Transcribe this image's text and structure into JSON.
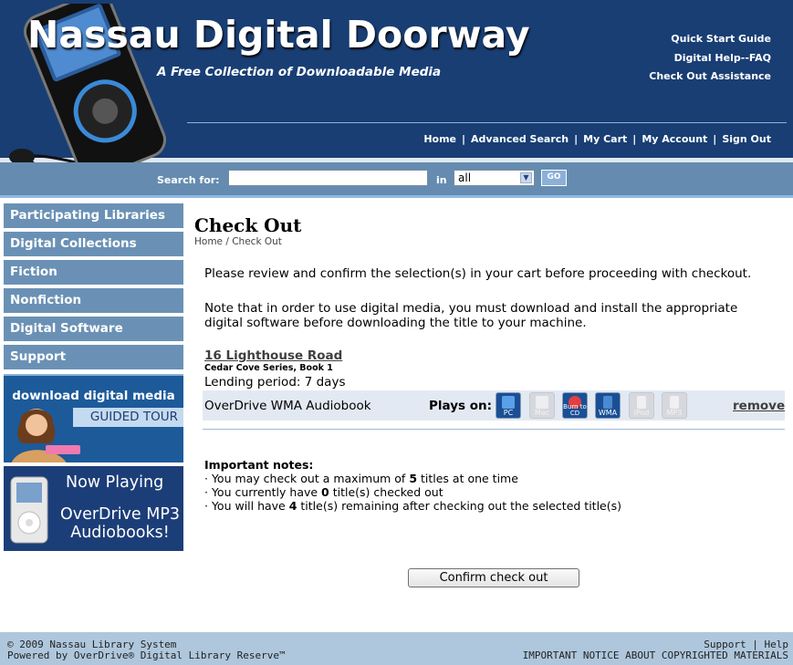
{
  "header": {
    "site_title": "Nassau Digital Doorway",
    "subtitle": "A Free Collection of Downloadable Media",
    "quick_links": [
      "Quick Start Guide",
      "Digital Help--FAQ",
      "Check Out Assistance"
    ],
    "nav": [
      "Home",
      "Advanced Search",
      "My Cart",
      "My Account",
      "Sign Out"
    ]
  },
  "search": {
    "label": "Search for:",
    "value": "",
    "in_label": "in",
    "scope": "all",
    "go_label": "GO"
  },
  "sidebar": {
    "items": [
      "Participating Libraries",
      "Digital Collections",
      "Fiction",
      "Nonfiction",
      "Digital Software",
      "Support"
    ],
    "promo_tour": {
      "line1": "download digital media",
      "line2": "GUIDED TOUR"
    },
    "promo_mp3": {
      "line1": "Now Playing",
      "line2": "OverDrive MP3",
      "line3": "Audiobooks!"
    }
  },
  "main": {
    "title": "Check Out",
    "breadcrumb": "Home / Check Out",
    "intro": "Please review and confirm the selection(s) in your cart before proceeding with checkout.",
    "note": "Note that in order to use digital media, you must download and install the appropriate digital software before downloading the title to your machine.",
    "item": {
      "title": "16 Lighthouse Road",
      "series": "Cedar Cove Series, Book 1",
      "lending": "Lending period: 7 days",
      "format": "OverDrive WMA Audiobook",
      "plays_on_label": "Plays on:",
      "devices": [
        {
          "name": "PC",
          "available": true,
          "color": "#1a4f95"
        },
        {
          "name": "Mac",
          "available": false,
          "color": "#d6d8de"
        },
        {
          "name": "Burn to CD",
          "available": true,
          "color": "#1a4f95"
        },
        {
          "name": "WMA",
          "available": true,
          "color": "#1a4f95"
        },
        {
          "name": "iPod",
          "available": false,
          "color": "#d6d8de"
        },
        {
          "name": "MP3",
          "available": false,
          "color": "#d6d8de"
        }
      ],
      "remove_label": "remove"
    },
    "important": {
      "heading": "Important notes:",
      "line1_pre": "· You may check out a maximum of ",
      "line1_bold": "5",
      "line1_post": " titles at one time",
      "line2_pre": "· You currently have ",
      "line2_bold": "0",
      "line2_post": " title(s) checked out",
      "line3_pre": "· You will have ",
      "line3_bold": "4",
      "line3_post": " title(s) remaining after checking out the selected title(s)"
    },
    "confirm_label": "Confirm check out"
  },
  "footer": {
    "copyright": "© 2009 Nassau Library System",
    "powered": "Powered by OverDrive® Digital Library Reserve™",
    "support": "Support",
    "help": "Help",
    "notice": "IMPORTANT NOTICE ABOUT COPYRIGHTED MATERIALS"
  },
  "colors": {
    "header_bg": "#183e74",
    "nav_bg": "#6a91b5",
    "search_bar_bg": "#658cb0",
    "footer_bg": "#aec7dc"
  }
}
